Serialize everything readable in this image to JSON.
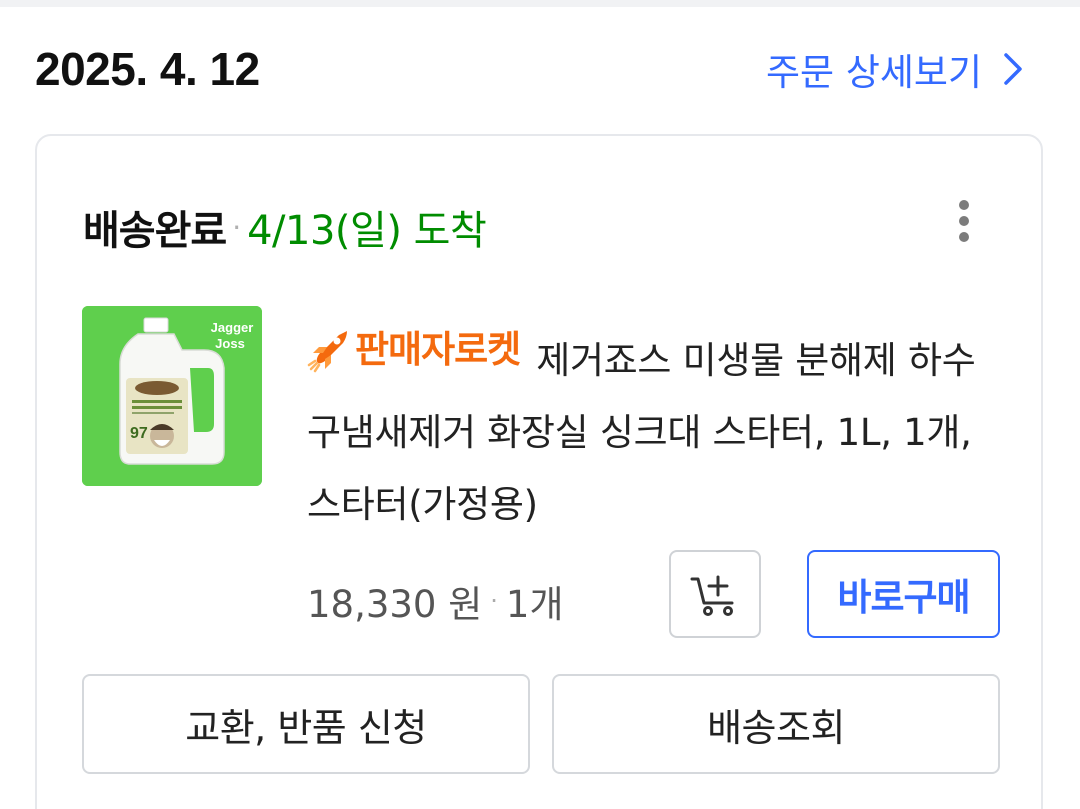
{
  "order": {
    "date": "2025. 4. 12",
    "detail_link_label": "주문 상세보기"
  },
  "shipment": {
    "status_label": "배송완료",
    "separator": "·",
    "arrival_text": "4/13(일) 도착",
    "status_color": "#008c00"
  },
  "product": {
    "badge_label": "판매자로켓",
    "badge_icon": "rocket-icon",
    "title": "제거죠스 미생물 분해제 하수구냄새제거 화장실 싱크대 스타터, 1L, 1개, 스타터(가정용)",
    "thumbnail_brand": "Jagger Joss",
    "price": "18,330 원",
    "separator": "·",
    "quantity": "1개"
  },
  "actions": {
    "cart_icon": "add-to-cart-icon",
    "buy_now_label": "바로구매",
    "exchange_return_label": "교환, 반품 신청",
    "track_delivery_label": "배송조회"
  },
  "colors": {
    "accent": "#346aff",
    "badge": "#f46a0e",
    "thumbnail_bg": "#5fcf4d"
  }
}
